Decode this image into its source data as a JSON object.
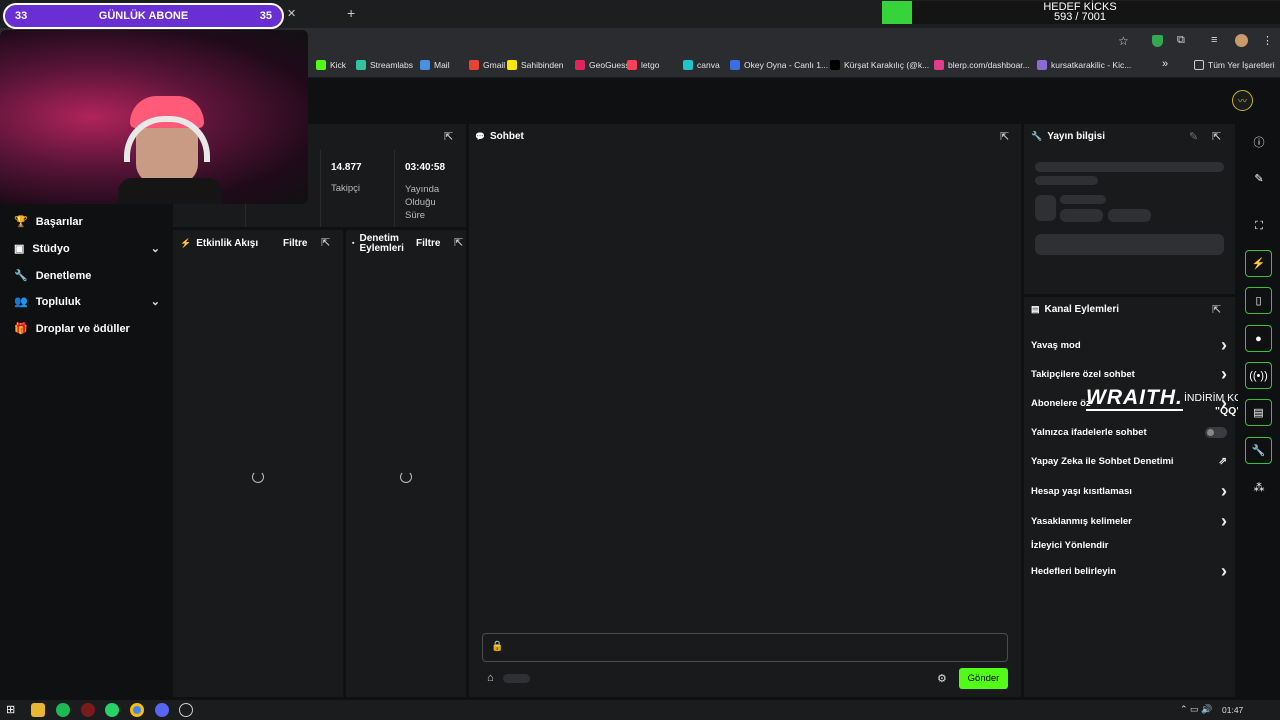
{
  "overlay": {
    "sub_left": "33",
    "sub_title": "GÜNLÜK ABONE",
    "sub_right": "35",
    "kicks_title": "HEDEF KİCKS",
    "kicks_count": "593 / 7001",
    "wraith_brand": "WRAITH.",
    "wraith_code_label": "İNDİRİM KODU:",
    "wraith_code": "\"QQ\""
  },
  "bookmarks": [
    {
      "label": "Kick",
      "color": "#53fc18"
    },
    {
      "label": "Streamlabs",
      "color": "#31c3a2"
    },
    {
      "label": "Mail",
      "color": "#4a90e2"
    },
    {
      "label": "Gmail",
      "color": "#ea4335"
    },
    {
      "label": "Sahibinden",
      "color": "#ffe800"
    },
    {
      "label": "GeoGuessr",
      "color": "#e0245e"
    },
    {
      "label": "letgo",
      "color": "#ff3f55"
    },
    {
      "label": "canva",
      "color": "#20c4cb"
    },
    {
      "label": "Okey Oyna - Canlı 1...",
      "color": "#3a6ee8"
    },
    {
      "label": "Kürşat Karakılıç (@k...",
      "color": "#000000"
    },
    {
      "label": "blerp.com/dashboar...",
      "color": "#e23d8a"
    },
    {
      "label": "kursatkarakilic - Kic...",
      "color": "#8a6bd6"
    }
  ],
  "bookmarks_more": "»",
  "bookmarks_all": "Tüm Yer İşaretleri",
  "sidebar": {
    "items": [
      {
        "label": "Başarılar",
        "icon": "trophy-icon"
      },
      {
        "label": "Stüdyo",
        "icon": "studio-icon",
        "chevron": "⌄"
      },
      {
        "label": "Denetleme",
        "icon": "wrench-icon"
      },
      {
        "label": "Topluluk",
        "icon": "community-icon",
        "chevron": "⌄"
      },
      {
        "label": "Droplar ve ödüller",
        "icon": "gift-icon"
      }
    ]
  },
  "stats": {
    "followers_value": "14.877",
    "followers_label": "Takipçi",
    "live_value": "03:40:58",
    "live_label": "Yayında Olduğu Süre"
  },
  "panels": {
    "activity_title": "Etkinlik Akışı",
    "activity_filter": "Filtre",
    "modactions_title": "Denetim Eylemleri",
    "modactions_filter": "Filtre",
    "chat_title": "Sohbet",
    "chat_send": "Gönder",
    "stream_info_title": "Yayın bilgisi",
    "channel_actions_title": "Kanal Eylemleri"
  },
  "channel_actions": [
    {
      "label": "Yavaş mod",
      "type": "arrow"
    },
    {
      "label": "Takipçilere özel sohbet",
      "type": "arrow"
    },
    {
      "label": "Abonelere öz",
      "type": "arrow"
    },
    {
      "label": "Yalnızca ifadelerle sohbet",
      "type": "toggle"
    },
    {
      "label": "Yapay Zeka ile Sohbet Denetimi",
      "type": "external"
    },
    {
      "label": "Hesap yaşı kısıtlaması",
      "type": "arrow"
    },
    {
      "label": "Yasaklanmış kelimeler",
      "type": "arrow"
    },
    {
      "label": "İzleyici Yönlendir",
      "type": "none"
    },
    {
      "label": "Hedefleri belirleyin",
      "type": "arrow"
    }
  ],
  "colors": {
    "accent": "#53fc18",
    "sub_bar": "#6a2fd2",
    "panel": "#191a1c",
    "background": "#0f1011"
  },
  "clock": "01:47"
}
